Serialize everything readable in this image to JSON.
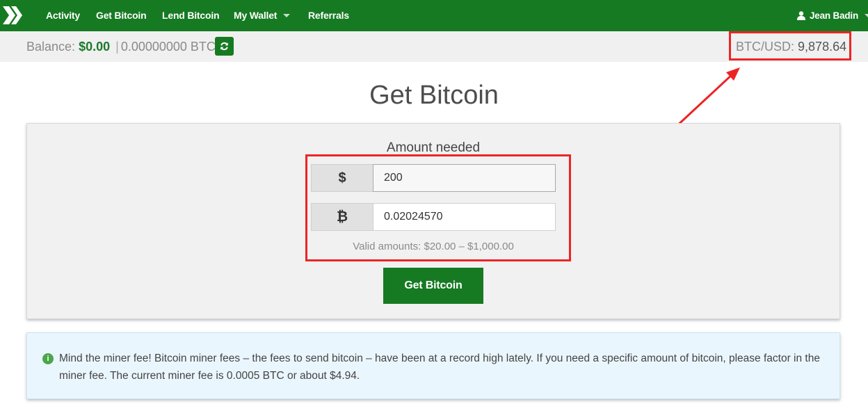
{
  "nav": {
    "items": [
      {
        "label": "Activity"
      },
      {
        "label": "Get Bitcoin"
      },
      {
        "label": "Lend Bitcoin"
      },
      {
        "label": "My Wallet"
      },
      {
        "label": "Referrals"
      }
    ],
    "user": "Jean Badin"
  },
  "balance": {
    "label": "Balance:",
    "usd": "$0.00",
    "separator": "|",
    "btc": "0.00000000 BTC"
  },
  "rate": {
    "label": "BTC/USD:",
    "value": "9,878.64"
  },
  "page_title": "Get Bitcoin",
  "form": {
    "amount_label": "Amount needed",
    "usd_symbol": "$",
    "usd_value": "200",
    "btc_symbol": "₿",
    "btc_value": "0.02024570",
    "valid_text": "Valid amounts: $20.00 – $1,000.00",
    "submit_label": "Get Bitcoin"
  },
  "info": {
    "icon": "i",
    "text": "Mind the miner fee! Bitcoin miner fees – the fees to send bitcoin – have been at a record high lately. If you need a specific amount of bitcoin, please factor in the miner fee. The current miner fee is 0.0005 BTC or about $4.94."
  },
  "colors": {
    "brand_green": "#167a22",
    "annotation_red": "#ed2424",
    "info_bg": "#eaf6fd"
  }
}
